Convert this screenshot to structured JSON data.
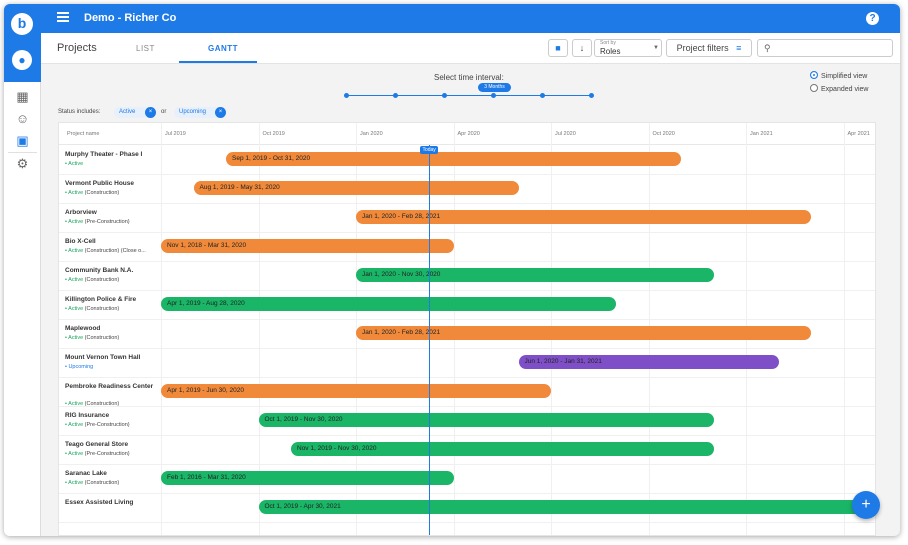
{
  "app": {
    "title": "Demo - Richer Co"
  },
  "tabs": {
    "projects_title": "Projects",
    "list": "LIST",
    "gantt": "GANTT"
  },
  "toolbar": {
    "sort_by_label": "Sort by",
    "sort_by_value": "Roles",
    "filters_label": "Project filters",
    "search_placeholder": ""
  },
  "interval": {
    "label": "Select time interval:",
    "selected": "3 Months",
    "stops": 6,
    "selected_index": 3
  },
  "view": {
    "simplified": "Simplified view",
    "expanded": "Expanded view",
    "selected": "simplified"
  },
  "status_filter": {
    "label": "Status includes:",
    "chips": [
      "Active",
      "Upcoming"
    ],
    "joiner": "or"
  },
  "gantt": {
    "column_header": "Project name",
    "months": [
      "Jul 2019",
      "Oct 2019",
      "Jan 2020",
      "Apr 2020",
      "Jul 2020",
      "Oct 2020",
      "Jan 2021",
      "Apr 2021"
    ],
    "today_label": "Today",
    "rows": [
      {
        "name": "Murphy Theater - Phase I",
        "status": "Active",
        "detail": "",
        "bar": "Sep 1, 2019 - Oct 31, 2020",
        "color": "orange"
      },
      {
        "name": "Vermont Public House",
        "status": "Active",
        "detail": "(Construction)",
        "bar": "Aug 1, 2019 - May 31, 2020",
        "color": "orange"
      },
      {
        "name": "Arborview",
        "status": "Active",
        "detail": "(Pre-Construction)",
        "bar": "Jan 1, 2020 - Feb 28, 2021",
        "color": "orange"
      },
      {
        "name": "Bio X-Cell",
        "status": "Active",
        "detail": "(Construction) (Close o...",
        "bar": "Nov 1, 2018 - Mar 31, 2020",
        "color": "orange"
      },
      {
        "name": "Community Bank N.A.",
        "status": "Active",
        "detail": "(Construction)",
        "bar": "Jan 1, 2020 - Nov 30, 2020",
        "color": "green"
      },
      {
        "name": "Killington Police & Fire",
        "status": "Active",
        "detail": "(Construction)",
        "bar": "Apr 1, 2019 - Aug 28, 2020",
        "color": "green"
      },
      {
        "name": "Maplewood",
        "status": "Active",
        "detail": "(Construction)",
        "bar": "Jan 1, 2020 - Feb 28, 2021",
        "color": "orange"
      },
      {
        "name": "Mount Vernon Town Hall",
        "status": "Upcoming",
        "detail": "",
        "bar": "Jun 1, 2020 - Jan 31, 2021",
        "color": "purple"
      },
      {
        "name": "Pembroke Readiness Center",
        "status": "Active",
        "detail": "(Construction)",
        "bar": "Apr 1, 2019 - Jun 30, 2020",
        "color": "orange"
      },
      {
        "name": "RIG Insurance",
        "status": "Active",
        "detail": "(Pre-Construction)",
        "bar": "Oct 1, 2019 - Nov 30, 2020",
        "color": "green"
      },
      {
        "name": "Teago General Store",
        "status": "Active",
        "detail": "(Pre-Construction)",
        "bar": "Nov 1, 2019 - Nov 30, 2020",
        "color": "green"
      },
      {
        "name": "Saranac Lake",
        "status": "Active",
        "detail": "(Construction)",
        "bar": "Feb 1, 2016 - Mar 31, 2020",
        "color": "green"
      },
      {
        "name": "Essex Assisted Living",
        "status": "",
        "detail": "",
        "bar": "Oct 1, 2019 - Apr 30, 2021",
        "color": "green"
      }
    ]
  },
  "colors": {
    "accent": "#1e7ae6",
    "orange": "#f0893a",
    "green": "#1ab566",
    "purple": "#7e4fc6"
  }
}
